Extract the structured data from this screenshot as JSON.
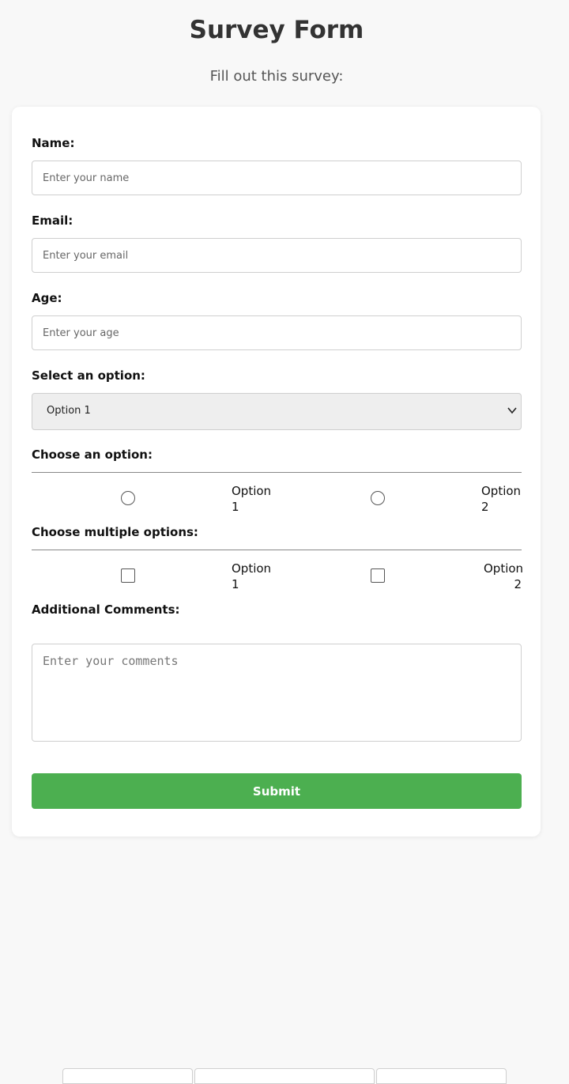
{
  "header": {
    "title": "Survey Form",
    "subtitle": "Fill out this survey:"
  },
  "form": {
    "name": {
      "label": "Name:",
      "placeholder": "Enter your name",
      "value": ""
    },
    "email": {
      "label": "Email:",
      "placeholder": "Enter your email",
      "value": ""
    },
    "age": {
      "label": "Age:",
      "placeholder": "Enter your age",
      "value": ""
    },
    "select": {
      "label": "Select an option:",
      "selected": "Option 1",
      "icon": "chevron-down-icon"
    },
    "radio_group": {
      "label": "Choose an option:",
      "options": [
        {
          "label": "Option 1",
          "checked": false
        },
        {
          "label": "Option 2",
          "checked": false
        }
      ]
    },
    "checkbox_group": {
      "label": "Choose multiple options:",
      "options": [
        {
          "label": "Option 1",
          "checked": false
        },
        {
          "label": "Option 2",
          "checked": false
        }
      ]
    },
    "comments": {
      "label": "Additional Comments:",
      "placeholder": "Enter your comments",
      "value": ""
    },
    "submit_label": "Submit"
  },
  "colors": {
    "page_background": "#f8f8f8",
    "card_background": "#ffffff",
    "submit_button": "#4caf50",
    "select_background": "#eeeeee"
  }
}
